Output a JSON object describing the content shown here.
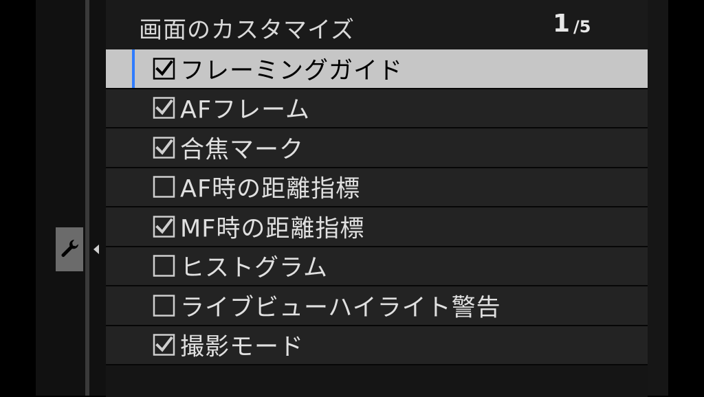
{
  "menu": {
    "title": "画面のカスタマイズ",
    "page_current": "1",
    "page_total": "/5"
  },
  "side_tab": {
    "icon": "wrench-icon"
  },
  "items": [
    {
      "label": "フレーミングガイド",
      "checked": true,
      "selected": true
    },
    {
      "label": "AFフレーム",
      "checked": true,
      "selected": false
    },
    {
      "label": "合焦マーク",
      "checked": true,
      "selected": false
    },
    {
      "label": "AF時の距離指標",
      "checked": false,
      "selected": false
    },
    {
      "label": "MF時の距離指標",
      "checked": true,
      "selected": false
    },
    {
      "label": "ヒストグラム",
      "checked": false,
      "selected": false
    },
    {
      "label": "ライブビューハイライト警告",
      "checked": false,
      "selected": false
    },
    {
      "label": "撮影モード",
      "checked": true,
      "selected": false
    }
  ],
  "colors": {
    "selection_accent": "#2f7cff",
    "selected_bg": "#c6c6c6",
    "row_bg": "#232323"
  }
}
